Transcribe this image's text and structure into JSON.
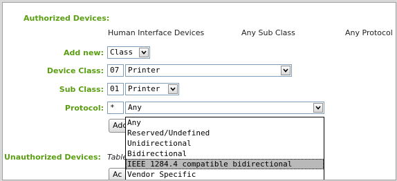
{
  "authorized": {
    "label": "Authorized Devices:",
    "header": {
      "device": "Human Interface Devices",
      "subclass": "Any Sub Class",
      "protocol": "Any Protocol"
    }
  },
  "add_new": {
    "label": "Add new:",
    "value": "Class"
  },
  "device_class": {
    "label": "Device Class:",
    "code": "07",
    "value": "Printer"
  },
  "sub_class": {
    "label": "Sub Class:",
    "code": "01",
    "value": "Printer"
  },
  "protocol": {
    "label": "Protocol:",
    "code": "*",
    "value": "Any",
    "options": [
      "Any",
      "Reserved/Undefined",
      "Unidirectional",
      "Bidirectional",
      "IEEE 1284.4 compatible bidirectional",
      "Vendor Specific"
    ],
    "highlighted_index": 4
  },
  "add_button_label": "Add",
  "unauthorized": {
    "label": "Unauthorized Devices:",
    "note": "Table"
  },
  "add_button_label_2": "Ac",
  "colors": {
    "label_green": "#5a9e12",
    "selection_gray": "#b9b9b9"
  }
}
